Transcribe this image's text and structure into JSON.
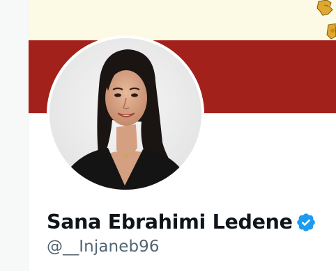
{
  "profile": {
    "display_name": "Sana Ebrahimi Ledene",
    "handle": "@__Injaneb96",
    "verified": true,
    "avatar_alt": "profile photo"
  },
  "banner": {
    "top_color": "#fcfae4",
    "bottom_color": "#a2211a",
    "emblem_color": "#e0a82e"
  },
  "colors": {
    "name_text": "#0f1419",
    "handle_text": "#536471",
    "verified_badge": "#1d9bf0"
  }
}
